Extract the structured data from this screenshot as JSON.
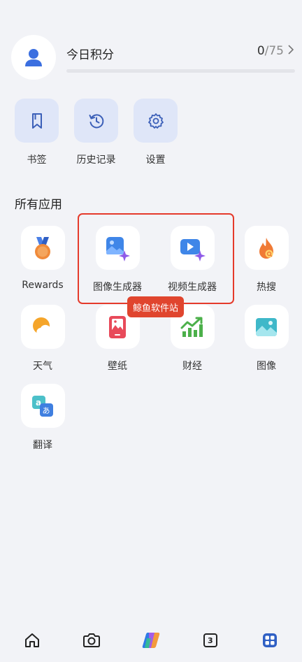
{
  "score": {
    "title": "今日积分",
    "current": "0",
    "total": "/75",
    "progress_fraction": 0
  },
  "quick_actions": [
    {
      "label": "书签",
      "icon": "bookmark-icon"
    },
    {
      "label": "历史记录",
      "icon": "history-icon"
    },
    {
      "label": "设置",
      "icon": "gear-icon"
    }
  ],
  "section_title": "所有应用",
  "apps": [
    {
      "label": "Rewards",
      "icon": "medal-icon"
    },
    {
      "label": "图像生成器",
      "icon": "image-generator-icon"
    },
    {
      "label": "视频生成器",
      "icon": "video-generator-icon"
    },
    {
      "label": "热搜",
      "icon": "flame-icon"
    },
    {
      "label": "天气",
      "icon": "weather-icon"
    },
    {
      "label": "壁纸",
      "icon": "wallpaper-icon"
    },
    {
      "label": "财经",
      "icon": "finance-icon"
    },
    {
      "label": "图像",
      "icon": "image-icon"
    },
    {
      "label": "翻译",
      "icon": "translate-icon"
    }
  ],
  "watermark": "鲸鱼软件站",
  "bottom_nav": {
    "tab_count": "3",
    "items": [
      "home-icon",
      "camera-icon",
      "copilot-icon",
      "tabs-icon",
      "apps-grid-icon"
    ]
  },
  "colors": {
    "accent": "#3b6fe0",
    "background": "#f2f3f7",
    "highlight": "#e53a2b"
  }
}
